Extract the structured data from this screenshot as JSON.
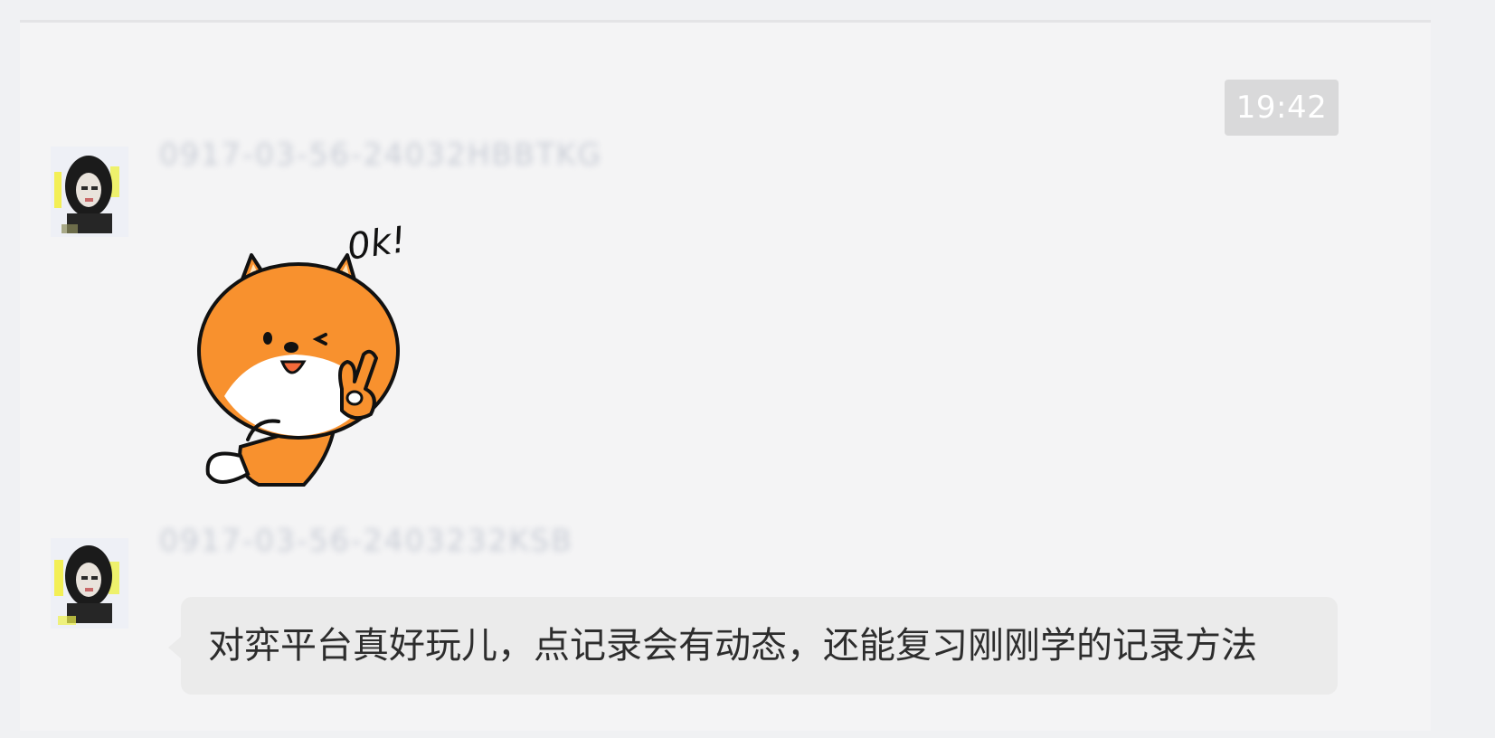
{
  "chat": {
    "timestamp": "19:42",
    "messages": [
      {
        "sender": "0917-03-56-24032HBBTKG",
        "type": "sticker",
        "sticker": {
          "caption": "0k!",
          "icon": "ok-fox-sticker"
        },
        "avatar_icon": "user-avatar-icon"
      },
      {
        "sender": "0917-03-56-2403232KSB",
        "type": "text",
        "text": "对弈平台真好玩儿，点记录会有动态，还能复习刚刚学的记录方法",
        "avatar_icon": "user-avatar-icon"
      }
    ]
  },
  "colors": {
    "page_background": "#f0f1f3",
    "panel_background": "#f4f4f5",
    "timestamp_background": "#d9d9da",
    "bubble_background": "#ebebeb",
    "fox_orange": "#f8912e"
  }
}
